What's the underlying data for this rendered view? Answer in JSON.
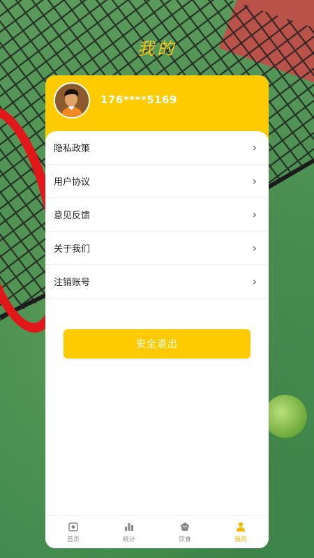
{
  "page": {
    "title": "我的"
  },
  "user": {
    "phone": "176****5169"
  },
  "menu": {
    "items": [
      {
        "label": "隐私政策"
      },
      {
        "label": "用户协议"
      },
      {
        "label": "意见反馈"
      },
      {
        "label": "关于我们"
      },
      {
        "label": "注销账号"
      }
    ],
    "chevron": "›"
  },
  "actions": {
    "logout_label": "安全退出"
  },
  "tabbar": {
    "tabs": [
      {
        "label": "首页",
        "icon": "camera-home-icon"
      },
      {
        "label": "统计",
        "icon": "bar-chart-icon"
      },
      {
        "label": "饮食",
        "icon": "food-icon"
      },
      {
        "label": "我的",
        "icon": "user-icon",
        "active": true
      }
    ]
  },
  "colors": {
    "accent": "#fecb00",
    "title": "#f6c31a",
    "active_tab": "#f2b800"
  }
}
